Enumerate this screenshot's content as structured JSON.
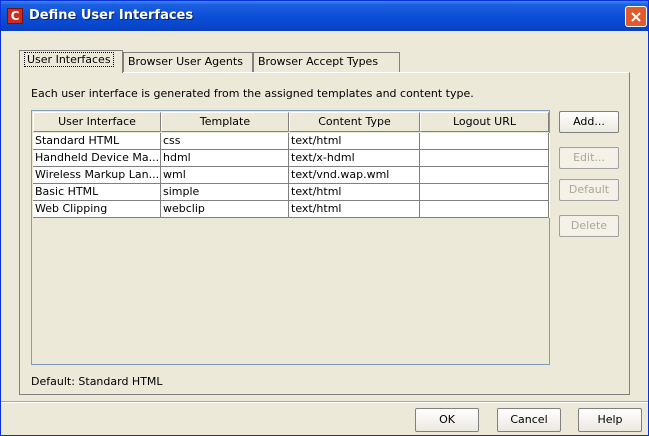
{
  "window": {
    "title": "Define User Interfaces",
    "app_icon_glyph": "C",
    "title_color": "#0a4ed8"
  },
  "tabs": [
    {
      "label": "User Interfaces",
      "active": true
    },
    {
      "label": "Browser User Agents",
      "active": false
    },
    {
      "label": "Browser Accept Types",
      "active": false
    }
  ],
  "description": "Each user interface is generated from the assigned templates and content type.",
  "table": {
    "columns": [
      "User Interface",
      "Template",
      "Content Type",
      "Logout URL"
    ],
    "rows": [
      [
        "Standard HTML",
        "css",
        "text/html",
        ""
      ],
      [
        "Handheld Device Ma...",
        "hdml",
        "text/x-hdml",
        ""
      ],
      [
        "Wireless Markup Lan...",
        "wml",
        "text/vnd.wap.wml",
        ""
      ],
      [
        "Basic HTML",
        "simple",
        "text/html",
        ""
      ],
      [
        "Web Clipping",
        "webclip",
        "text/html",
        ""
      ]
    ]
  },
  "side_buttons": {
    "add": "Add...",
    "edit": "Edit...",
    "default": "Default",
    "delete": "Delete"
  },
  "default_label": "Default:  Standard HTML",
  "footer": {
    "ok": "OK",
    "cancel": "Cancel",
    "help": "Help"
  },
  "icons": {
    "close": "close-icon",
    "app": "app-icon"
  }
}
